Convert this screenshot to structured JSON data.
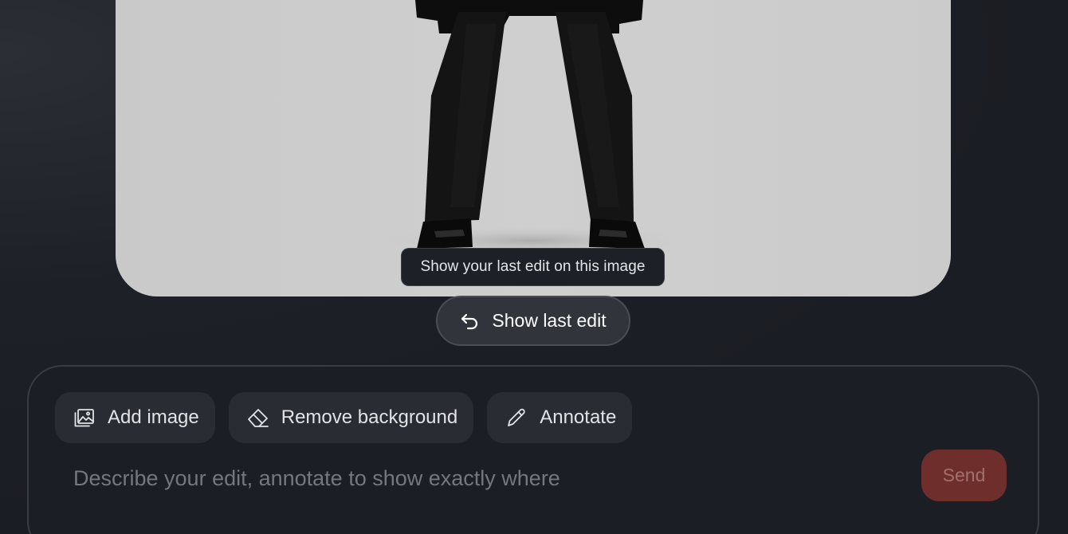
{
  "image_card": {
    "description_icon": "image-preview"
  },
  "tooltip": {
    "text": "Show your last edit on this image"
  },
  "show_last_edit": {
    "label": "Show last edit",
    "icon": "undo-icon"
  },
  "composer": {
    "tools": [
      {
        "label": "Add image",
        "icon": "add-image-icon"
      },
      {
        "label": "Remove background",
        "icon": "eraser-icon"
      },
      {
        "label": "Annotate",
        "icon": "pencil-icon"
      }
    ],
    "input": {
      "placeholder": "Describe your edit, annotate to show exactly where",
      "value": ""
    },
    "send_label": "Send"
  },
  "colors": {
    "background": "#1b1d24",
    "send_button": "#6e2e2b",
    "image_background": "#cccccc"
  }
}
